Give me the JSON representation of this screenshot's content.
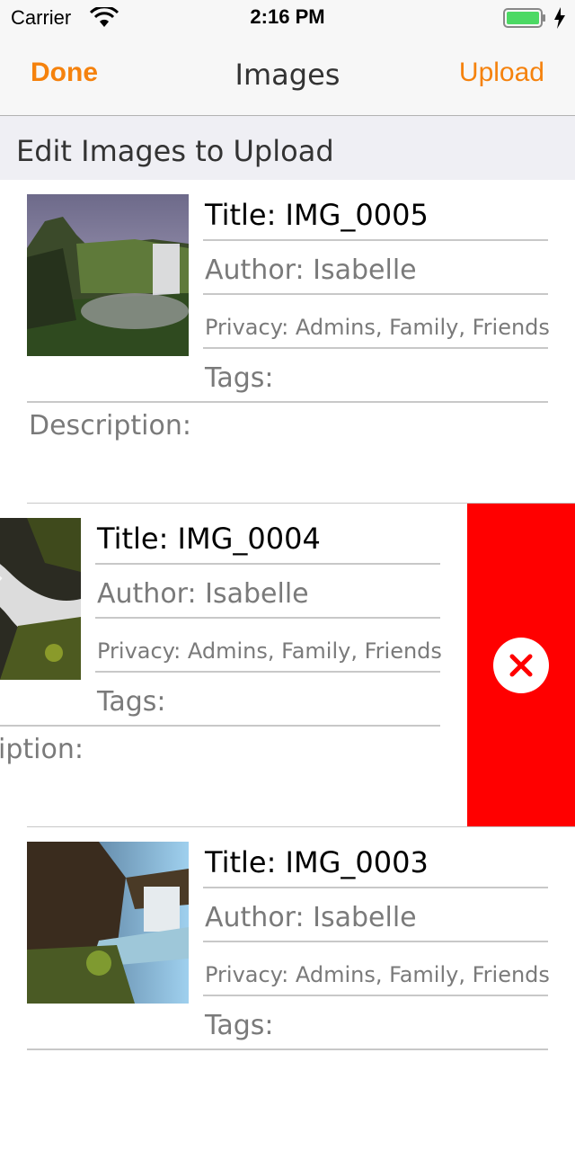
{
  "status_bar": {
    "carrier": "Carrier",
    "time": "2:16 PM",
    "wifi_icon": "wifi-icon",
    "battery_icon": "battery-icon",
    "charging_icon": "bolt-icon",
    "battery_color": "#4cd964"
  },
  "nav": {
    "done_label": "Done",
    "title": "Images",
    "upload_label": "Upload",
    "accent_color": "#f5820d"
  },
  "section": {
    "title": "Edit Images to Upload"
  },
  "images": [
    {
      "title": "Title: IMG_0005",
      "author": "Author: Isabelle",
      "privacy": "Privacy: Admins, Family, Friends",
      "tags": "Tags:",
      "description": "Description:"
    },
    {
      "title": "Title: IMG_0004",
      "author": "Author: Isabelle",
      "privacy": "Privacy: Admins, Family, Friends",
      "tags": "Tags:",
      "description": "Description:",
      "delete_icon": "close-icon",
      "delete_color": "#ff0000"
    },
    {
      "title": "Title: IMG_0003",
      "author": "Author: Isabelle",
      "privacy": "Privacy: Admins, Family, Friends",
      "tags": "Tags:"
    }
  ]
}
